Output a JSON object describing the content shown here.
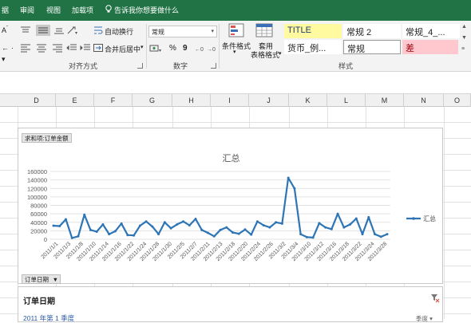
{
  "ribbon_tabs": [
    "据",
    "审阅",
    "视图",
    "加载项"
  ],
  "tell_me": "告诉我你想要做什么",
  "alignment": {
    "wrap_text": "自动换行",
    "merge_center": "合并后居中",
    "group_label": "对齐方式"
  },
  "number": {
    "format_value": "常规",
    "percent": "%",
    "comma": "9",
    "group_label": "数字"
  },
  "styles": {
    "conditional_formatting": "条件格式",
    "format_as_table_1": "套用",
    "format_as_table_2": "表格格式",
    "cells": [
      {
        "text": "TITLE",
        "bg": "#fffaa0",
        "color": "#1f3a70"
      },
      {
        "text": "常规 2",
        "bg": "#ffffff",
        "color": "#222222"
      },
      {
        "text": "常规_4_...",
        "bg": "#ffffff",
        "color": "#222222"
      },
      {
        "text": "货币_例...",
        "bg": "#ffffff",
        "color": "#222222"
      },
      {
        "text": "常规",
        "bg": "#ffffff",
        "color": "#222222"
      },
      {
        "text": "差",
        "bg": "#ffc7ce",
        "color": "#9c0006"
      }
    ],
    "group_label": "样式"
  },
  "columns": [
    "D",
    "E",
    "F",
    "G",
    "H",
    "I",
    "J",
    "K",
    "L",
    "M",
    "N",
    "O"
  ],
  "pivot_field_button": "求和项:订单金额",
  "axis_field_button": "订单日期",
  "chart_data": {
    "type": "line",
    "title": "汇总",
    "ylim": [
      0,
      160000
    ],
    "y_ticks": [
      0,
      20000,
      40000,
      60000,
      80000,
      100000,
      120000,
      140000,
      160000
    ],
    "x_tick_labels": [
      "2011/1/1",
      "2011/1/3",
      "2011/1/8",
      "2011/1/10",
      "2011/1/14",
      "2011/1/16",
      "2011/1/22",
      "2011/1/24",
      "2011/1/28",
      "2011/1/30",
      "2011/2/5",
      "2011/2/7",
      "2011/2/11",
      "2011/2/13",
      "2011/2/18",
      "2011/2/20",
      "2011/2/24",
      "2011/2/26",
      "2011/3/2",
      "2011/3/4",
      "2011/3/10",
      "2011/3/12",
      "2011/3/16",
      "2011/3/18",
      "2011/3/22",
      "2011/3/24",
      "2011/3/28"
    ],
    "series": [
      {
        "name": "汇总",
        "color": "#2e75b6",
        "values": [
          32000,
          31000,
          47000,
          3000,
          7000,
          58000,
          22000,
          18000,
          35000,
          12000,
          19000,
          37000,
          10000,
          9000,
          32000,
          42000,
          30000,
          12000,
          40000,
          26000,
          35000,
          42000,
          33000,
          48000,
          22000,
          15000,
          7000,
          22000,
          28000,
          16000,
          13000,
          23000,
          11000,
          42000,
          33000,
          28000,
          40000,
          37000,
          145000,
          120000,
          12000,
          5000,
          4000,
          38000,
          28000,
          24000,
          60000,
          28000,
          35000,
          49000,
          12000,
          52000,
          12000,
          6000,
          12000
        ]
      }
    ],
    "legend_position": "right",
    "grid": true
  },
  "slicer": {
    "title": "订单日期",
    "item": "2011 年第 1 季度",
    "level": "季度"
  }
}
